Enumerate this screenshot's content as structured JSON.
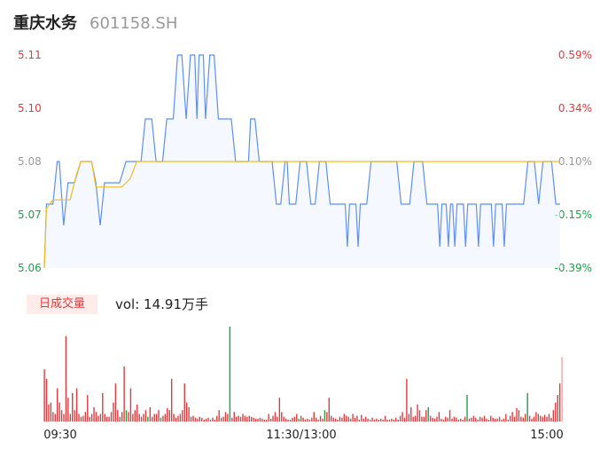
{
  "header": {
    "name": "重庆水务",
    "code": "601158.SH"
  },
  "volume_panel": {
    "tab_label": "日成交量",
    "vol_text": "vol: 14.91万手"
  },
  "colors": {
    "price": "#5b8ff9",
    "avg": "#f6bd16",
    "up": "#e4393c",
    "down": "#1aa34a",
    "axis_neutral": "#999999"
  },
  "chart_data": [
    {
      "type": "line",
      "y_ticks_left": [
        "5.11",
        "5.10",
        "5.08",
        "5.07",
        "5.06"
      ],
      "y_ticks_right": [
        "0.59%",
        "0.34%",
        "0.10%",
        "-0.15%",
        "-0.39%"
      ],
      "x_ticks": [
        "09:30",
        "11:30/13:00",
        "15:00"
      ],
      "ylim": [
        5.06,
        5.11
      ],
      "x_count": 241,
      "series": [
        {
          "key": "price",
          "segments": [
            [
              0,
              5.06
            ],
            [
              1,
              5.075
            ],
            [
              4,
              5.075
            ],
            [
              6,
              5.085
            ],
            [
              7,
              5.085
            ],
            [
              9,
              5.07
            ],
            [
              11,
              5.08
            ],
            [
              14,
              5.08
            ],
            [
              17,
              5.085
            ],
            [
              22,
              5.085
            ],
            [
              24,
              5.08
            ],
            [
              26,
              5.07
            ],
            [
              28,
              5.08
            ],
            [
              35,
              5.08
            ],
            [
              38,
              5.085
            ],
            [
              45,
              5.085
            ],
            [
              47,
              5.095
            ],
            [
              50,
              5.095
            ],
            [
              52,
              5.085
            ],
            [
              55,
              5.085
            ],
            [
              57,
              5.095
            ],
            [
              60,
              5.095
            ],
            [
              62,
              5.11
            ],
            [
              64,
              5.11
            ],
            [
              66,
              5.095
            ],
            [
              68,
              5.11
            ],
            [
              70,
              5.11
            ],
            [
              71,
              5.095
            ],
            [
              72,
              5.11
            ],
            [
              74,
              5.11
            ],
            [
              75,
              5.095
            ],
            [
              77,
              5.11
            ],
            [
              79,
              5.11
            ],
            [
              81,
              5.095
            ],
            [
              87,
              5.095
            ],
            [
              89,
              5.085
            ],
            [
              95,
              5.085
            ],
            [
              96,
              5.095
            ],
            [
              98,
              5.095
            ],
            [
              100,
              5.085
            ],
            [
              106,
              5.085
            ],
            [
              108,
              5.075
            ],
            [
              110,
              5.075
            ],
            [
              112,
              5.085
            ],
            [
              113,
              5.085
            ],
            [
              114,
              5.075
            ],
            [
              117,
              5.075
            ],
            [
              119,
              5.085
            ],
            [
              122,
              5.085
            ],
            [
              124,
              5.075
            ],
            [
              126,
              5.075
            ],
            [
              128,
              5.085
            ],
            [
              131,
              5.085
            ],
            [
              133,
              5.075
            ],
            [
              140,
              5.075
            ],
            [
              141,
              5.065
            ],
            [
              142,
              5.075
            ],
            [
              145,
              5.075
            ],
            [
              146,
              5.065
            ],
            [
              147,
              5.075
            ],
            [
              150,
              5.075
            ],
            [
              152,
              5.085
            ],
            [
              164,
              5.085
            ],
            [
              166,
              5.075
            ],
            [
              170,
              5.075
            ],
            [
              172,
              5.085
            ],
            [
              176,
              5.085
            ],
            [
              178,
              5.075
            ],
            [
              183,
              5.075
            ],
            [
              184,
              5.065
            ],
            [
              185,
              5.075
            ],
            [
              187,
              5.075
            ],
            [
              188,
              5.065
            ],
            [
              189,
              5.075
            ],
            [
              190,
              5.075
            ],
            [
              191,
              5.065
            ],
            [
              192,
              5.075
            ],
            [
              195,
              5.075
            ],
            [
              196,
              5.065
            ],
            [
              197,
              5.075
            ],
            [
              201,
              5.075
            ],
            [
              202,
              5.065
            ],
            [
              203,
              5.075
            ],
            [
              208,
              5.075
            ],
            [
              209,
              5.065
            ],
            [
              210,
              5.075
            ],
            [
              213,
              5.075
            ],
            [
              214,
              5.065
            ],
            [
              215,
              5.075
            ],
            [
              223,
              5.075
            ],
            [
              225,
              5.085
            ],
            [
              228,
              5.085
            ],
            [
              230,
              5.075
            ],
            [
              232,
              5.085
            ],
            [
              236,
              5.085
            ],
            [
              238,
              5.075
            ],
            [
              240,
              5.075
            ]
          ]
        },
        {
          "key": "avg",
          "segments": [
            [
              0,
              5.06
            ],
            [
              1,
              5.074
            ],
            [
              4,
              5.076
            ],
            [
              9,
              5.076
            ],
            [
              12,
              5.076
            ],
            [
              14,
              5.08
            ],
            [
              15,
              5.082
            ],
            [
              17,
              5.085
            ],
            [
              22,
              5.085
            ],
            [
              24,
              5.079
            ],
            [
              30,
              5.079
            ],
            [
              36,
              5.079
            ],
            [
              40,
              5.081
            ],
            [
              43,
              5.085
            ],
            [
              240,
              5.085
            ]
          ]
        }
      ]
    },
    {
      "type": "bar",
      "x_count": 241,
      "values": [
        0.55,
        0.45,
        0.18,
        0.2,
        0.1,
        0.08,
        0.35,
        0.2,
        0.12,
        0.08,
        0.9,
        0.25,
        0.08,
        0.3,
        0.12,
        0.35,
        0.08,
        0.05,
        0.06,
        0.1,
        0.28,
        0.05,
        0.08,
        0.15,
        0.1,
        0.06,
        0.08,
        0.3,
        0.08,
        0.05,
        0.05,
        0.1,
        0.2,
        0.4,
        0.12,
        0.05,
        0.1,
        0.58,
        0.12,
        0.1,
        0.35,
        0.08,
        0.12,
        0.18,
        0.08,
        0.05,
        0.08,
        0.12,
        0.05,
        0.15,
        0.05,
        0.08,
        0.08,
        0.12,
        0.04,
        0.06,
        0.08,
        0.14,
        0.12,
        0.45,
        0.08,
        0.04,
        0.06,
        0.08,
        0.12,
        0.4,
        0.2,
        0.15,
        0.05,
        0.06,
        0.04,
        0.03,
        0.05,
        0.04,
        0.02,
        0.03,
        0.04,
        0.02,
        0.04,
        0.02,
        0.06,
        0.12,
        0.04,
        0.05,
        0.1,
        0.08,
        1.0,
        0.04,
        0.1,
        0.05,
        0.06,
        0.05,
        0.08,
        0.06,
        0.05,
        0.06,
        0.05,
        0.04,
        0.03,
        0.03,
        0.04,
        0.03,
        0.02,
        0.02,
        0.08,
        0.03,
        0.06,
        0.1,
        0.05,
        0.25,
        0.1,
        0.05,
        0.03,
        0.02,
        0.02,
        0.04,
        0.05,
        0.08,
        0.03,
        0.06,
        0.04,
        0.02,
        0.03,
        0.02,
        0.04,
        0.1,
        0.04,
        0.02,
        0.06,
        0.03,
        0.12,
        0.1,
        0.25,
        0.06,
        0.04,
        0.03,
        0.02,
        0.05,
        0.04,
        0.08,
        0.06,
        0.05,
        0.03,
        0.08,
        0.04,
        0.06,
        0.02,
        0.07,
        0.03,
        0.05,
        0.03,
        0.02,
        0.04,
        0.02,
        0.03,
        0.02,
        0.03,
        0.02,
        0.06,
        0.02,
        0.02,
        0.03,
        0.02,
        0.04,
        0.02,
        0.06,
        0.1,
        0.04,
        0.45,
        0.08,
        0.15,
        0.05,
        0.06,
        0.18,
        0.12,
        0.05,
        0.05,
        0.12,
        0.15,
        0.06,
        0.04,
        0.03,
        0.05,
        0.1,
        0.03,
        0.02,
        0.05,
        0.04,
        0.12,
        0.03,
        0.05,
        0.04,
        0.02,
        0.03,
        0.02,
        0.05,
        0.28,
        0.03,
        0.04,
        0.06,
        0.04,
        0.02,
        0.05,
        0.04,
        0.06,
        0.03,
        0.02,
        0.06,
        0.04,
        0.03,
        0.03,
        0.05,
        0.02,
        0.03,
        0.08,
        0.02,
        0.06,
        0.1,
        0.05,
        0.14,
        0.12,
        0.05,
        0.04,
        0.08,
        0.3,
        0.06,
        0.03,
        0.05,
        0.1,
        0.08,
        0.06,
        0.05,
        0.07,
        0.05,
        0.08,
        0.04,
        0.12,
        0.2,
        0.28,
        0.4,
        0.68
      ]
    }
  ]
}
